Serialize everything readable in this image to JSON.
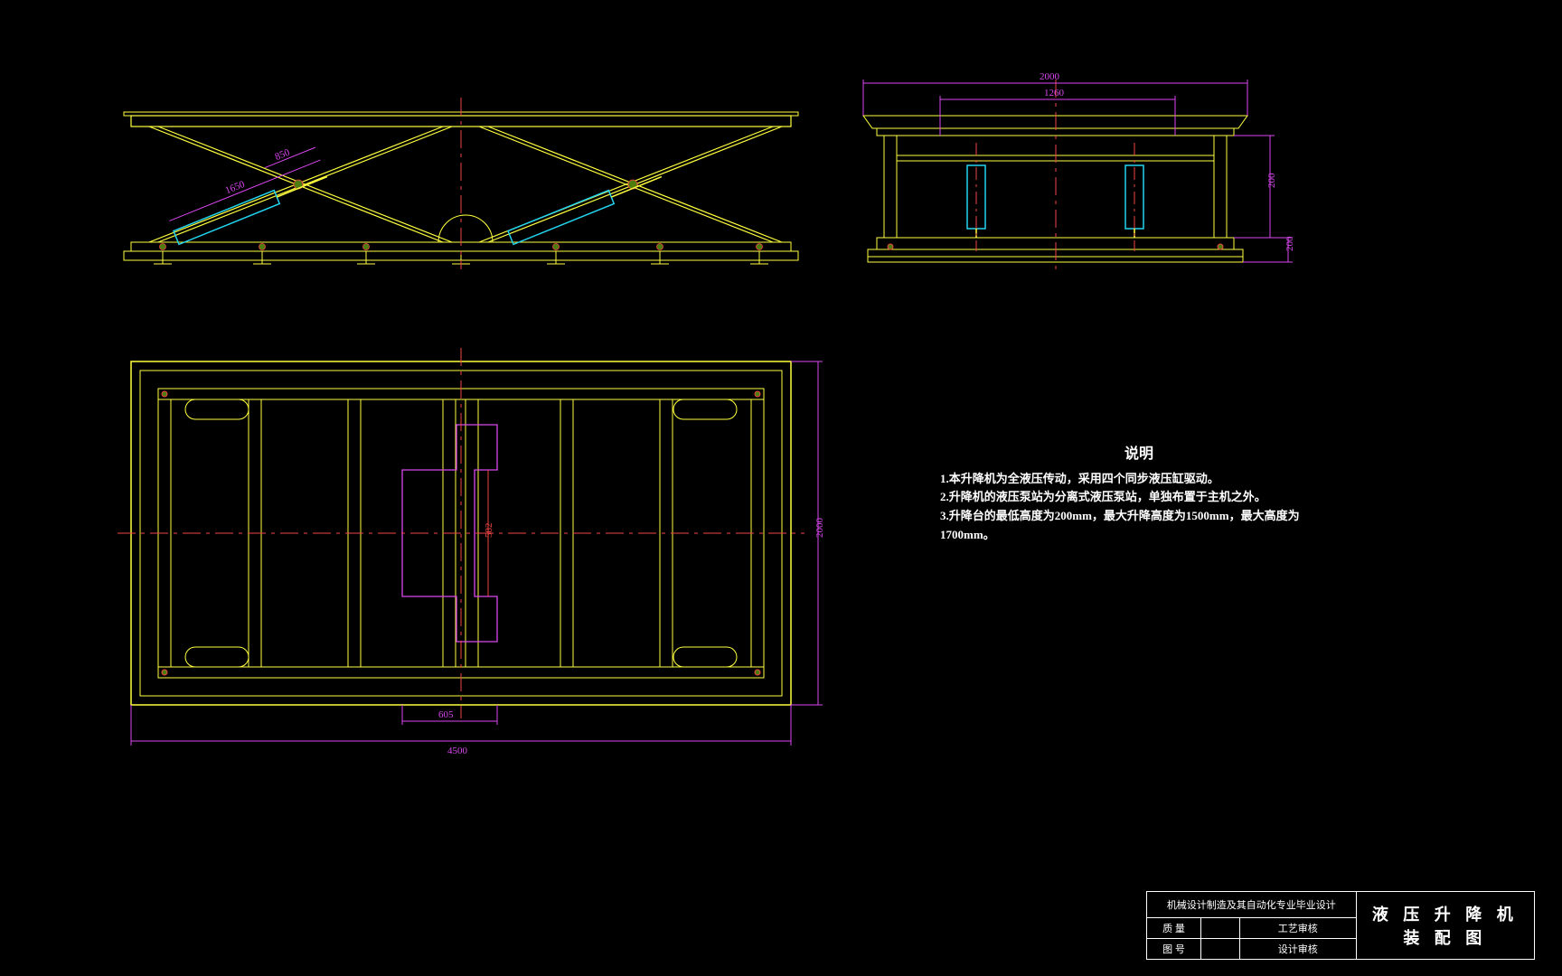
{
  "drawing_title": "液 压 升 降 机 装 配 图",
  "description": {
    "heading": "说明",
    "line1": "1.本升降机为全液压传动，采用四个同步液压缸驱动。",
    "line2": "2.升降机的液压泵站为分离式液压泵站，单独布置于主机之外。",
    "line3": "3.升降台的最低高度为200mm，最大升降高度为1500mm，最大高度为1700mm。"
  },
  "dimensions": {
    "side_width": "2000",
    "side_inner": "1260",
    "side_height": "200",
    "side_ext_min": "200",
    "plan_width": "4500",
    "plan_height": "2000",
    "plan_inner_w": "605",
    "plan_inner_h": "582",
    "front_cyl": "1650",
    "front_ext": "850"
  },
  "titleblock": {
    "header": "机械设计制造及其自动化专业毕业设计",
    "r1c1": "质 量",
    "r1c2": "工艺审核",
    "r2c1": "图 号",
    "r2c2": "设计审核"
  },
  "colors": {
    "outline": "#ffff3f",
    "accent": "#d946ef",
    "center": "#ef4444",
    "cyan": "#22d3ee",
    "fill": "#4d7c0f"
  }
}
